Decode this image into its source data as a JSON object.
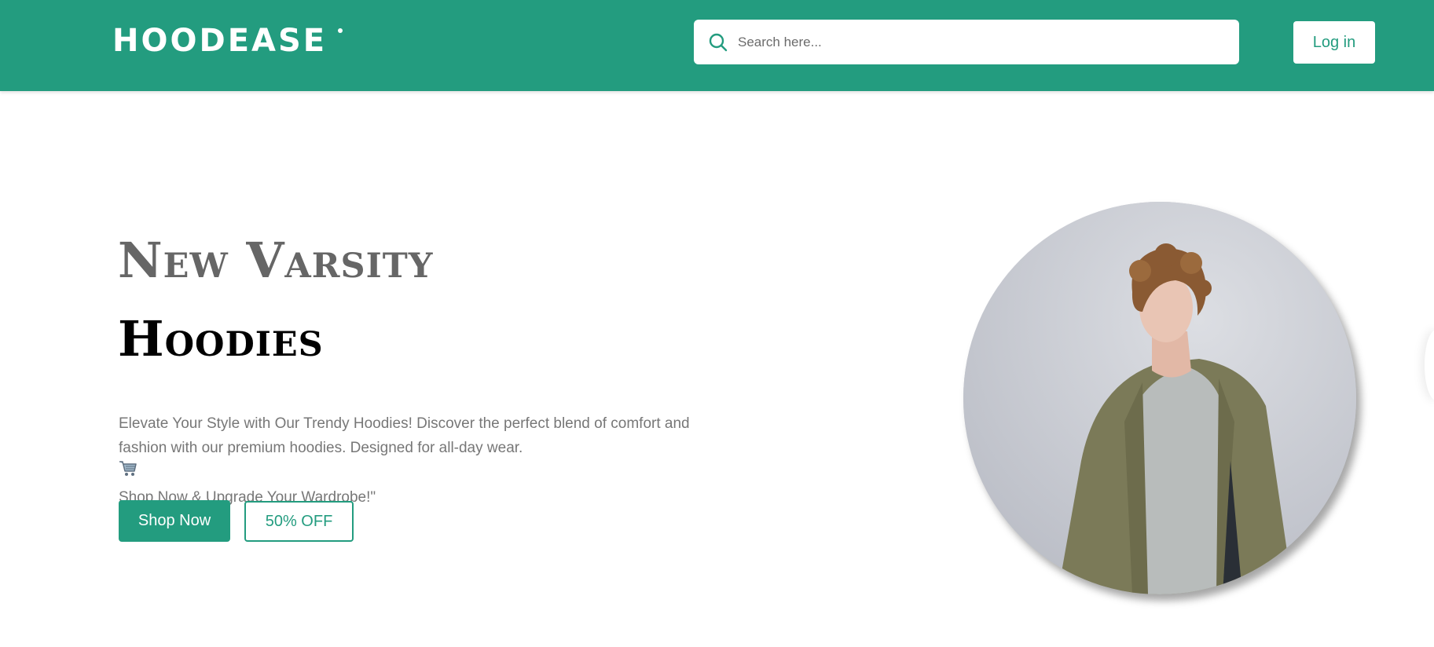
{
  "header": {
    "logo_text": "HOODEASE",
    "search_placeholder": "Search here...",
    "login_label": "Log in"
  },
  "hero": {
    "title_line1": "New Varsity",
    "title_line2": "Hoodies",
    "desc_line1": "Elevate Your Style with Our Trendy Hoodies! Discover the perfect blend of comfort and",
    "desc_line2": "fashion with our premium hoodies. Designed for all-day wear.",
    "desc_line3": "Shop Now & Upgrade Your Wardrobe!\"",
    "shop_label": "Shop Now",
    "offer_label": "50% OFF"
  },
  "icons": {
    "search": "search-icon",
    "cart": "cart-icon"
  },
  "colors": {
    "brand": "#239c7f",
    "title_gray": "#666666",
    "body_text": "#777777"
  }
}
